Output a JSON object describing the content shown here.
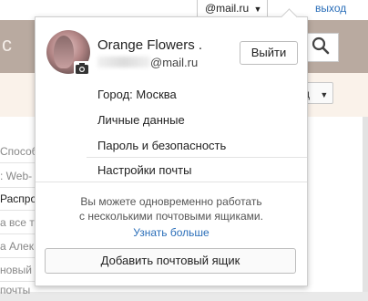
{
  "top": {
    "email": "@mail.ru",
    "logout": "выход"
  },
  "background": {
    "header_fragment": "с",
    "sort_fragment": "д",
    "rows": [
      "Способ",
      ": Web-",
      "Распро",
      "а все т",
      "а Алек",
      "новый",
      "почты"
    ]
  },
  "popup": {
    "user_name": "Orange Flowers .",
    "user_email": "@mail.ru",
    "logout_button": "Выйти",
    "menu": [
      "Город: Москва",
      "Личные данные",
      "Пароль и безопасность",
      "Настройки почты"
    ],
    "note_line1": "Вы можете одновременно работать",
    "note_line2": "с несколькими почтовыми ящиками.",
    "learn_more": "Узнать больше",
    "add_mailbox": "Добавить почтовый ящик"
  },
  "colors": {
    "link": "#2a6eb9",
    "header": "#b9aaa0"
  }
}
